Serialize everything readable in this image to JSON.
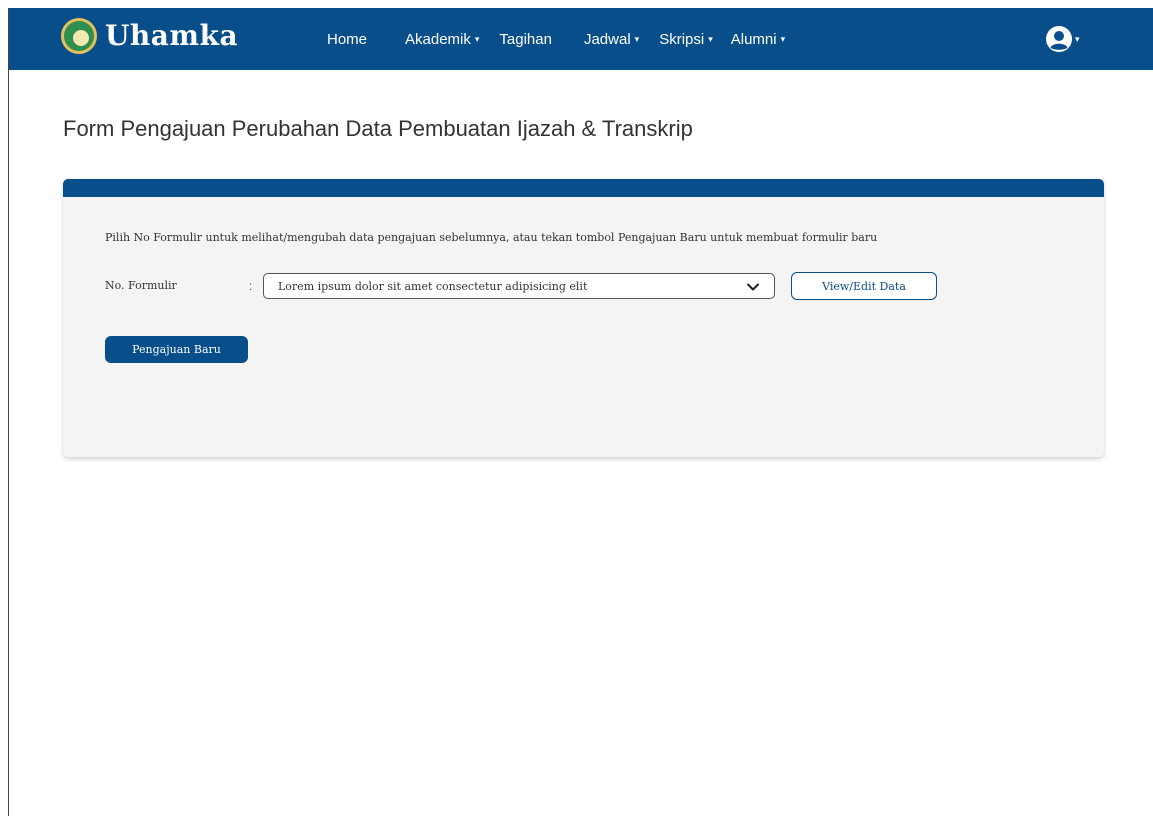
{
  "brand": {
    "name": "Uhamka",
    "logo_icon": "university-emblem-icon"
  },
  "nav": {
    "items": [
      {
        "label": "Home",
        "dropdown": false
      },
      {
        "label": "Akademik",
        "dropdown": true
      },
      {
        "label": "Tagihan",
        "dropdown": false
      },
      {
        "label": "Jadwal",
        "dropdown": true
      },
      {
        "label": "Skripsi",
        "dropdown": true
      },
      {
        "label": "Alumni",
        "dropdown": true
      }
    ],
    "caret": "▾",
    "user_icon": "user-circle-icon"
  },
  "page": {
    "title": "Form Pengajuan Perubahan Data Pembuatan Ijazah & Transkrip"
  },
  "form": {
    "instruction": "Pilih No Formulir untuk melihat/mengubah data pengajuan sebelumnya, atau tekan tombol Pengajuan Baru untuk membuat formulir baru",
    "label": "No. Formulir",
    "separator": ":",
    "selected_value": "Lorem ipsum dolor sit amet consectetur adipisicing elit",
    "view_button": "View/Edit Data",
    "new_button": "Pengajuan Baru"
  },
  "colors": {
    "primary": "#084e8a",
    "card_bg": "#f4f4f4",
    "white": "#ffffff"
  }
}
